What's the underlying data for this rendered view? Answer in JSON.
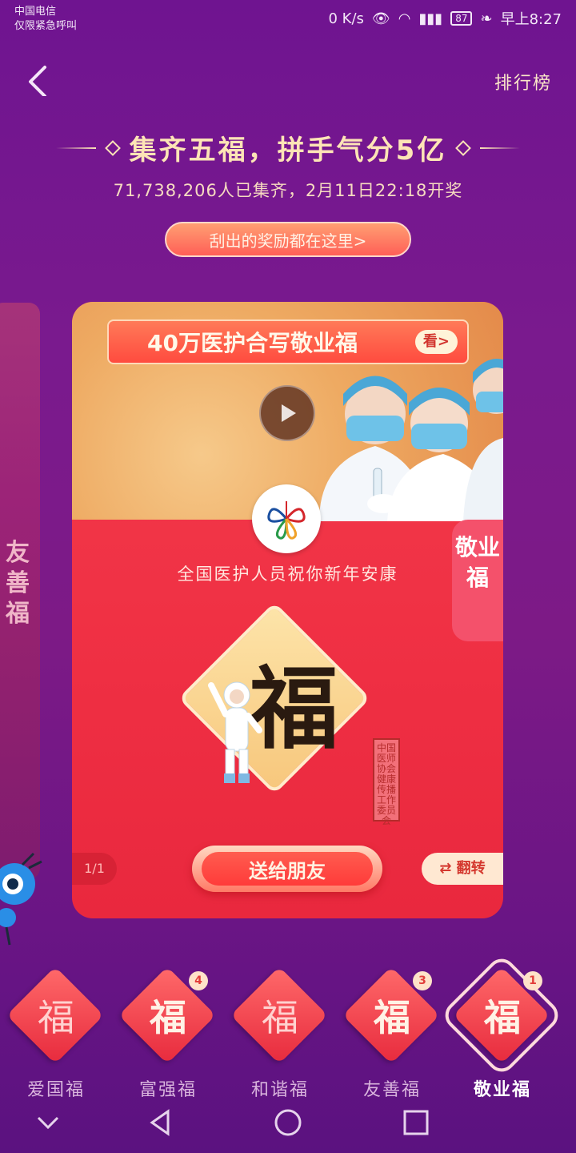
{
  "status_bar": {
    "carrier": "中国电信",
    "carrier_note": "仅限紧急呼叫",
    "speed": "0 K/s",
    "battery": "87",
    "time": "早上8:27"
  },
  "header": {
    "ranking_label": "排行榜",
    "title": "集齐五福，拼手气分5亿",
    "subtitle": "71,738,206人已集齐，2月11日22:18开奖",
    "reward_button": "刮出的奖励都在这里>"
  },
  "side_card_left": {
    "label": "友善福"
  },
  "card": {
    "banner_text": "40万医护合写敬业福",
    "banner_button": "看>",
    "greeting": "全国医护人员祝你新年安康",
    "tag": "敬业福",
    "fu_character": "福",
    "seal_text": "中国医师协会 健康传播工作委员会",
    "count": "1/1",
    "send_button": "送给朋友",
    "flip_button": "翻转"
  },
  "tabs": [
    {
      "char": "福",
      "label": "爱国福",
      "badge": "",
      "have": false,
      "active": false
    },
    {
      "char": "福",
      "label": "富强福",
      "badge": "4",
      "have": true,
      "active": false
    },
    {
      "char": "福",
      "label": "和谐福",
      "badge": "",
      "have": false,
      "active": false
    },
    {
      "char": "福",
      "label": "友善福",
      "badge": "3",
      "have": true,
      "active": false
    },
    {
      "char": "福",
      "label": "敬业福",
      "badge": "1",
      "have": true,
      "active": true
    }
  ],
  "colors": {
    "background": "#7a1a8e",
    "card_red": "#ef2f43",
    "gold_text": "#fde4b6"
  }
}
